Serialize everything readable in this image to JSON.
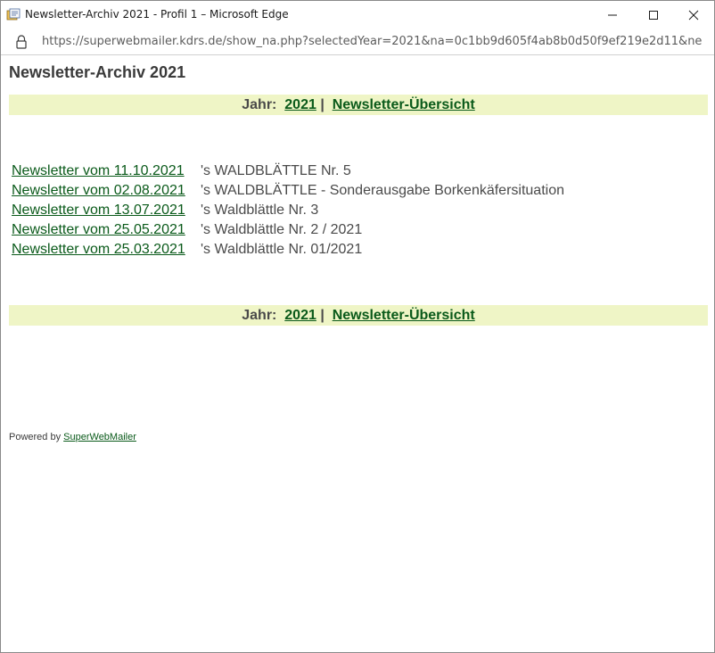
{
  "window": {
    "title": "Newsletter-Archiv 2021 - Profil 1 – Microsoft Edge",
    "url": "https://superwebmailer.kdrs.de/show_na.php?selectedYear=2021&na=0c1bb9d605f4ab8b0d50f9ef219e2d11&newsle…"
  },
  "page": {
    "title": "Newsletter-Archiv 2021",
    "nav": {
      "year_label": "Jahr:",
      "year_link": "2021",
      "separator": "|",
      "overview_link": "Newsletter-Übersicht"
    },
    "newsletters": [
      {
        "link": "Newsletter vom 11.10.2021",
        "subject": "'s WALDBLÄTTLE Nr. 5"
      },
      {
        "link": "Newsletter vom 02.08.2021",
        "subject": "'s WALDBLÄTTLE - Sonderausgabe Borkenkäfersituation"
      },
      {
        "link": "Newsletter vom 13.07.2021",
        "subject": "'s Waldblättle Nr. 3"
      },
      {
        "link": "Newsletter vom 25.05.2021",
        "subject": "'s Waldblättle Nr. 2 / 2021"
      },
      {
        "link": "Newsletter vom 25.03.2021",
        "subject": "'s Waldblättle Nr. 01/2021"
      }
    ],
    "footer": {
      "powered_by": "Powered by",
      "brand_link": "SuperWebMailer"
    }
  }
}
